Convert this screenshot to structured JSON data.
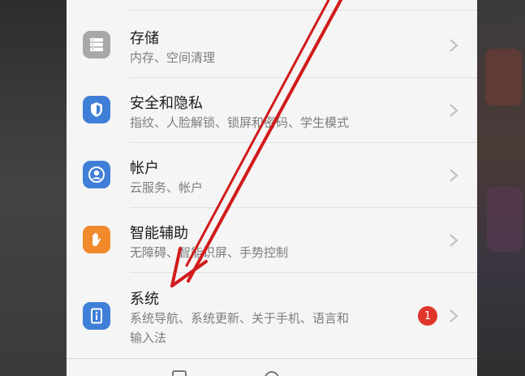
{
  "colors": {
    "panel_bg": "#f5f5f5",
    "storage_icon": "#a8a8a8",
    "security_icon": "#3f7fd8",
    "account_icon": "#3f7fd8",
    "assist_icon": "#f08a2b",
    "system_icon": "#3f7fd8",
    "badge": "#e0352b",
    "arrow": "#d11a1a"
  },
  "settings": {
    "items": [
      {
        "title": "存储",
        "subtitle": "内存、空间清理",
        "icon": "storage-icon"
      },
      {
        "title": "安全和隐私",
        "subtitle": "指纹、人脸解锁、锁屏和密码、学生模式",
        "icon": "shield-icon"
      },
      {
        "title": "帐户",
        "subtitle": "云服务、帐户",
        "icon": "account-icon"
      },
      {
        "title": "智能辅助",
        "subtitle": "无障碍、智能识屏、手势控制",
        "icon": "hand-icon"
      },
      {
        "title": "系统",
        "subtitle_line1": "系统导航、系统更新、关于手机、语言和",
        "subtitle_line2": "输入法",
        "icon": "system-icon",
        "badge": "1"
      }
    ]
  }
}
